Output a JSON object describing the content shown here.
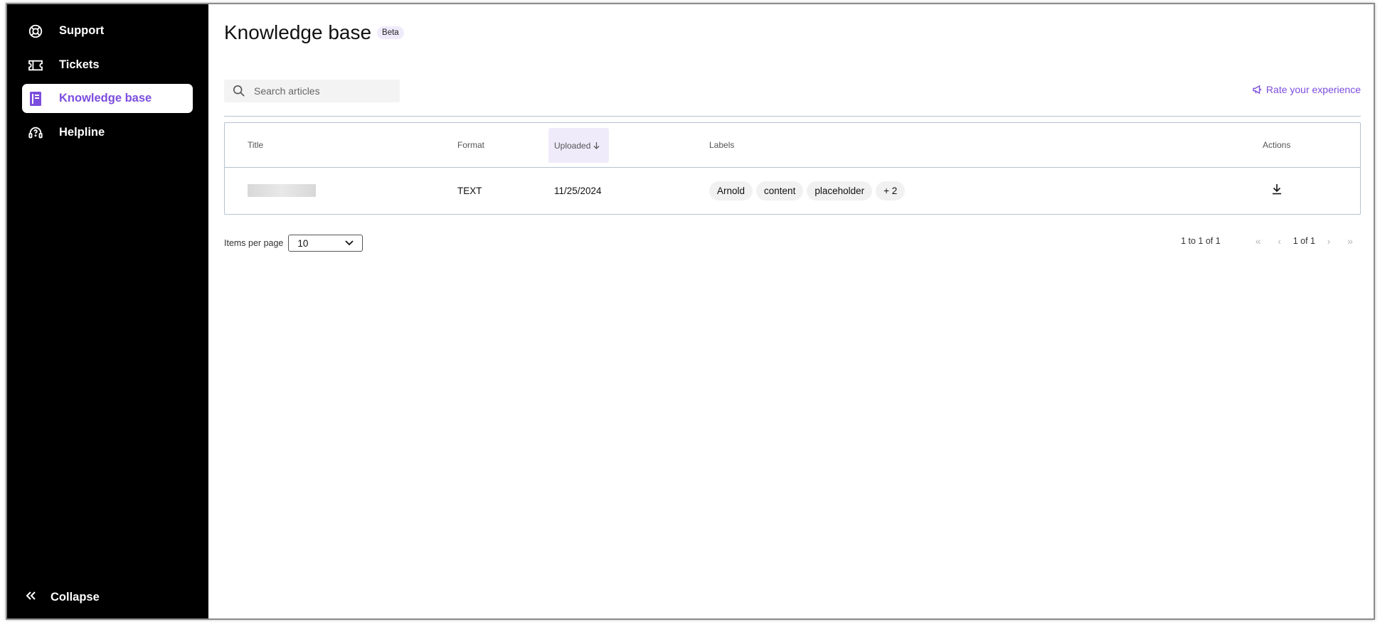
{
  "sidebar": {
    "items": [
      {
        "label": "Support",
        "icon": "lifebuoy-icon"
      },
      {
        "label": "Tickets",
        "icon": "ticket-icon"
      },
      {
        "label": "Knowledge base",
        "icon": "book-icon"
      },
      {
        "label": "Helpline",
        "icon": "headset-icon"
      }
    ],
    "active_index": 2,
    "collapse_label": "Collapse"
  },
  "header": {
    "title": "Knowledge base",
    "badge": "Beta"
  },
  "search": {
    "placeholder": "Search articles"
  },
  "rate_link": "Rate your experience",
  "table": {
    "columns": [
      "Title",
      "Format",
      "Uploaded",
      "Labels",
      "Actions"
    ],
    "sort_column": "Uploaded",
    "rows": [
      {
        "title": "",
        "format": "TEXT",
        "uploaded": "11/25/2024",
        "labels": [
          "Arnold",
          "content",
          "placeholder"
        ],
        "more_labels": "+ 2"
      }
    ]
  },
  "pagination": {
    "items_per_page_label": "Items per page",
    "items_per_page": "10",
    "range": "1 to 1 of 1",
    "pages": "1 of 1",
    "first": "«",
    "prev": "‹",
    "next": "›",
    "last": "»"
  },
  "colors": {
    "accent": "#7c4dde",
    "sidebar_bg": "#000000",
    "chip_bg": "#f1f1f2",
    "border": "#b6c3cf"
  }
}
